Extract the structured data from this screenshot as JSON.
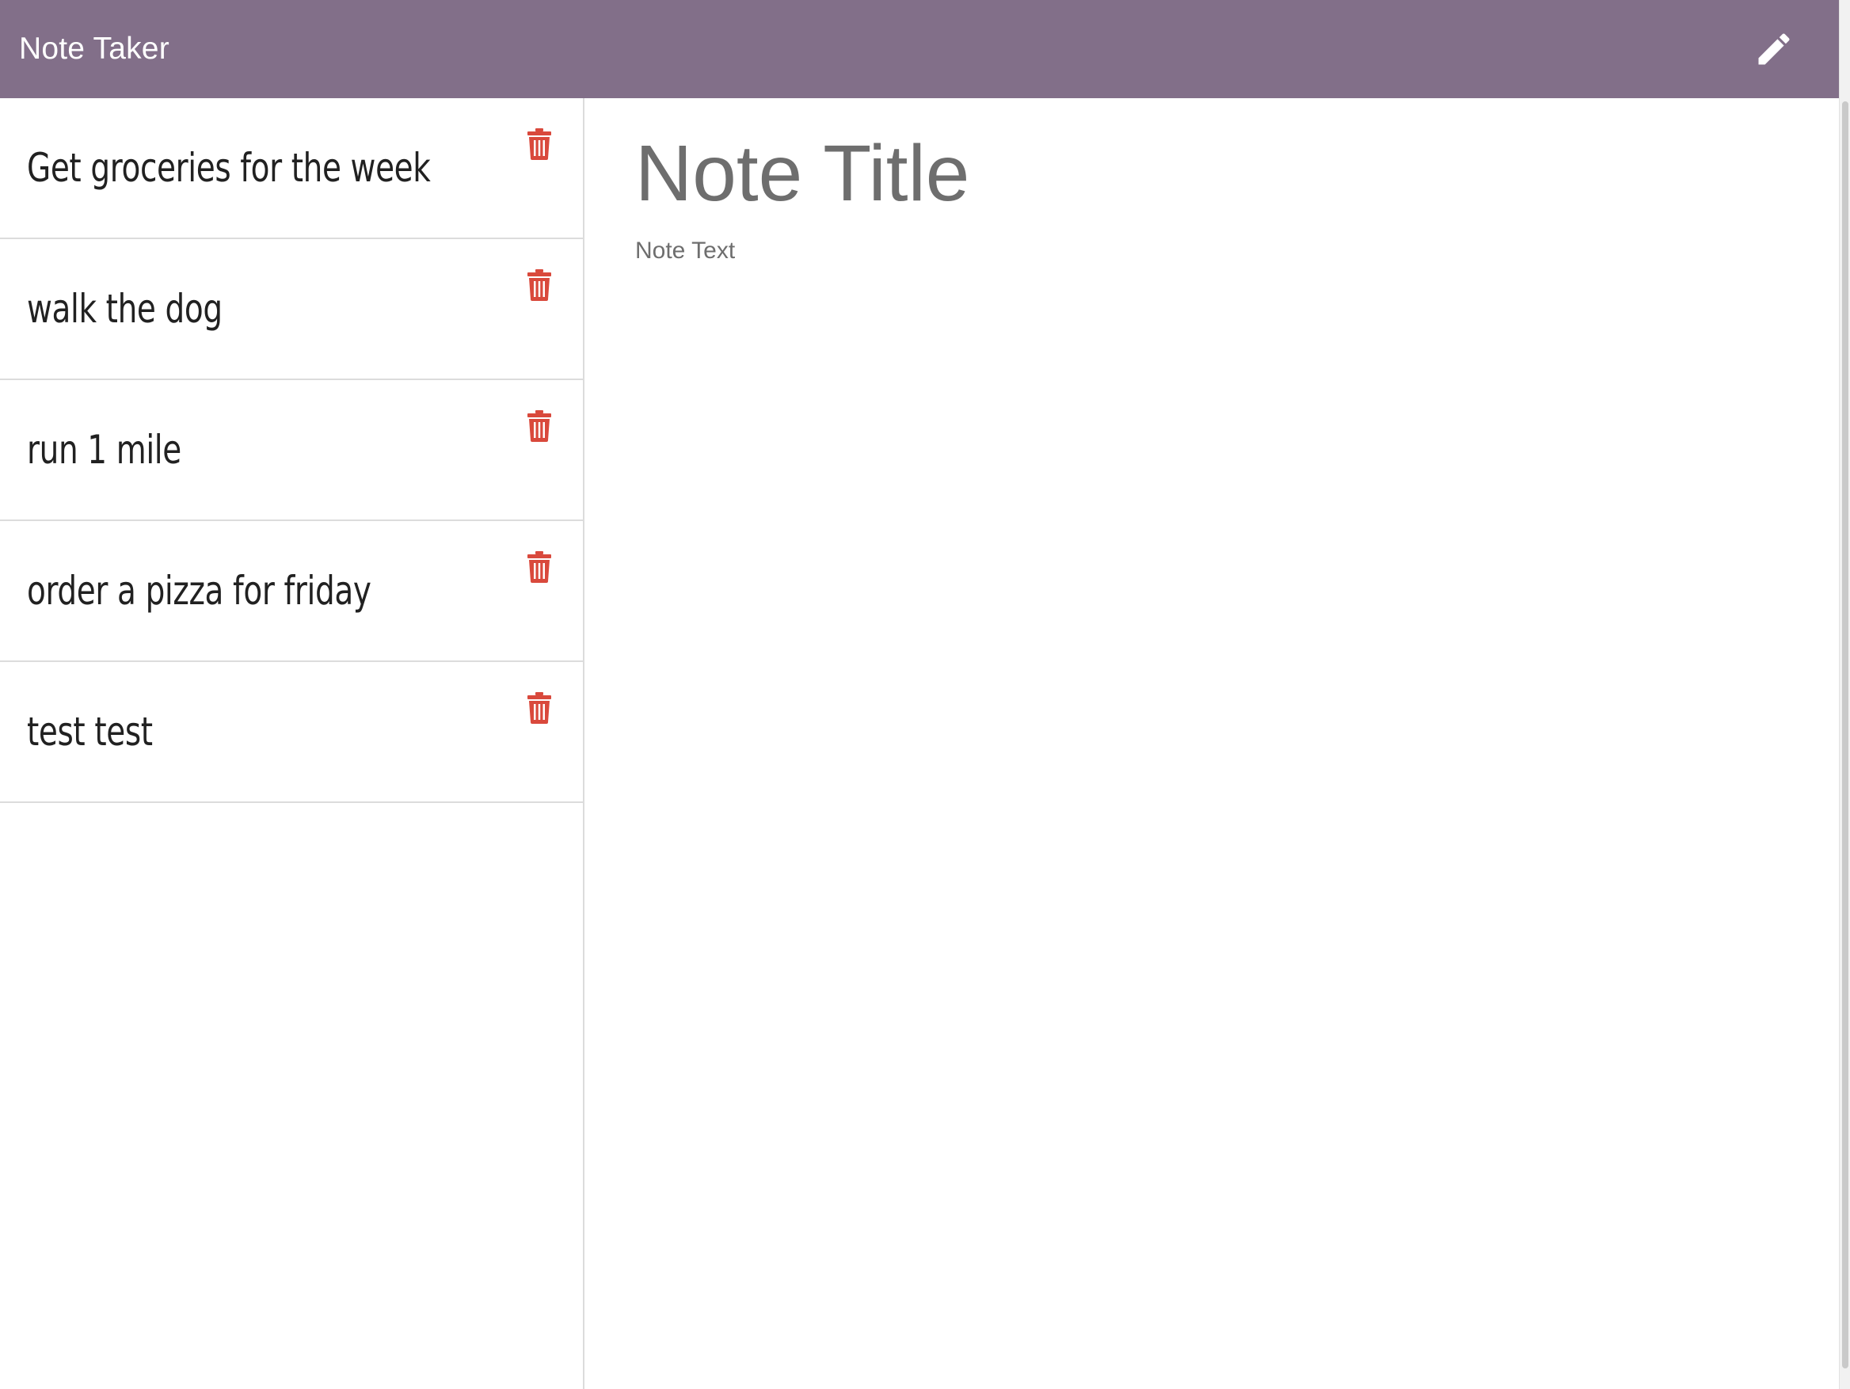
{
  "navbar": {
    "brand": "Note Taker",
    "new_note_icon": "pencil-icon",
    "background_color": "#826f89"
  },
  "notes": [
    {
      "title": "Get groceries for the week",
      "delete_icon": "trash-icon"
    },
    {
      "title": "walk the dog",
      "delete_icon": "trash-icon"
    },
    {
      "title": "run 1 mile",
      "delete_icon": "trash-icon"
    },
    {
      "title": "order a pizza for friday",
      "delete_icon": "trash-icon"
    },
    {
      "title": "test test",
      "delete_icon": "trash-icon"
    }
  ],
  "editor": {
    "title_placeholder": "Note Title",
    "text_placeholder": "Note Text",
    "title_value": "",
    "text_value": ""
  },
  "colors": {
    "delete_icon": "#d9493c",
    "placeholder_text": "#6e6e6e",
    "note_text": "#212121"
  }
}
